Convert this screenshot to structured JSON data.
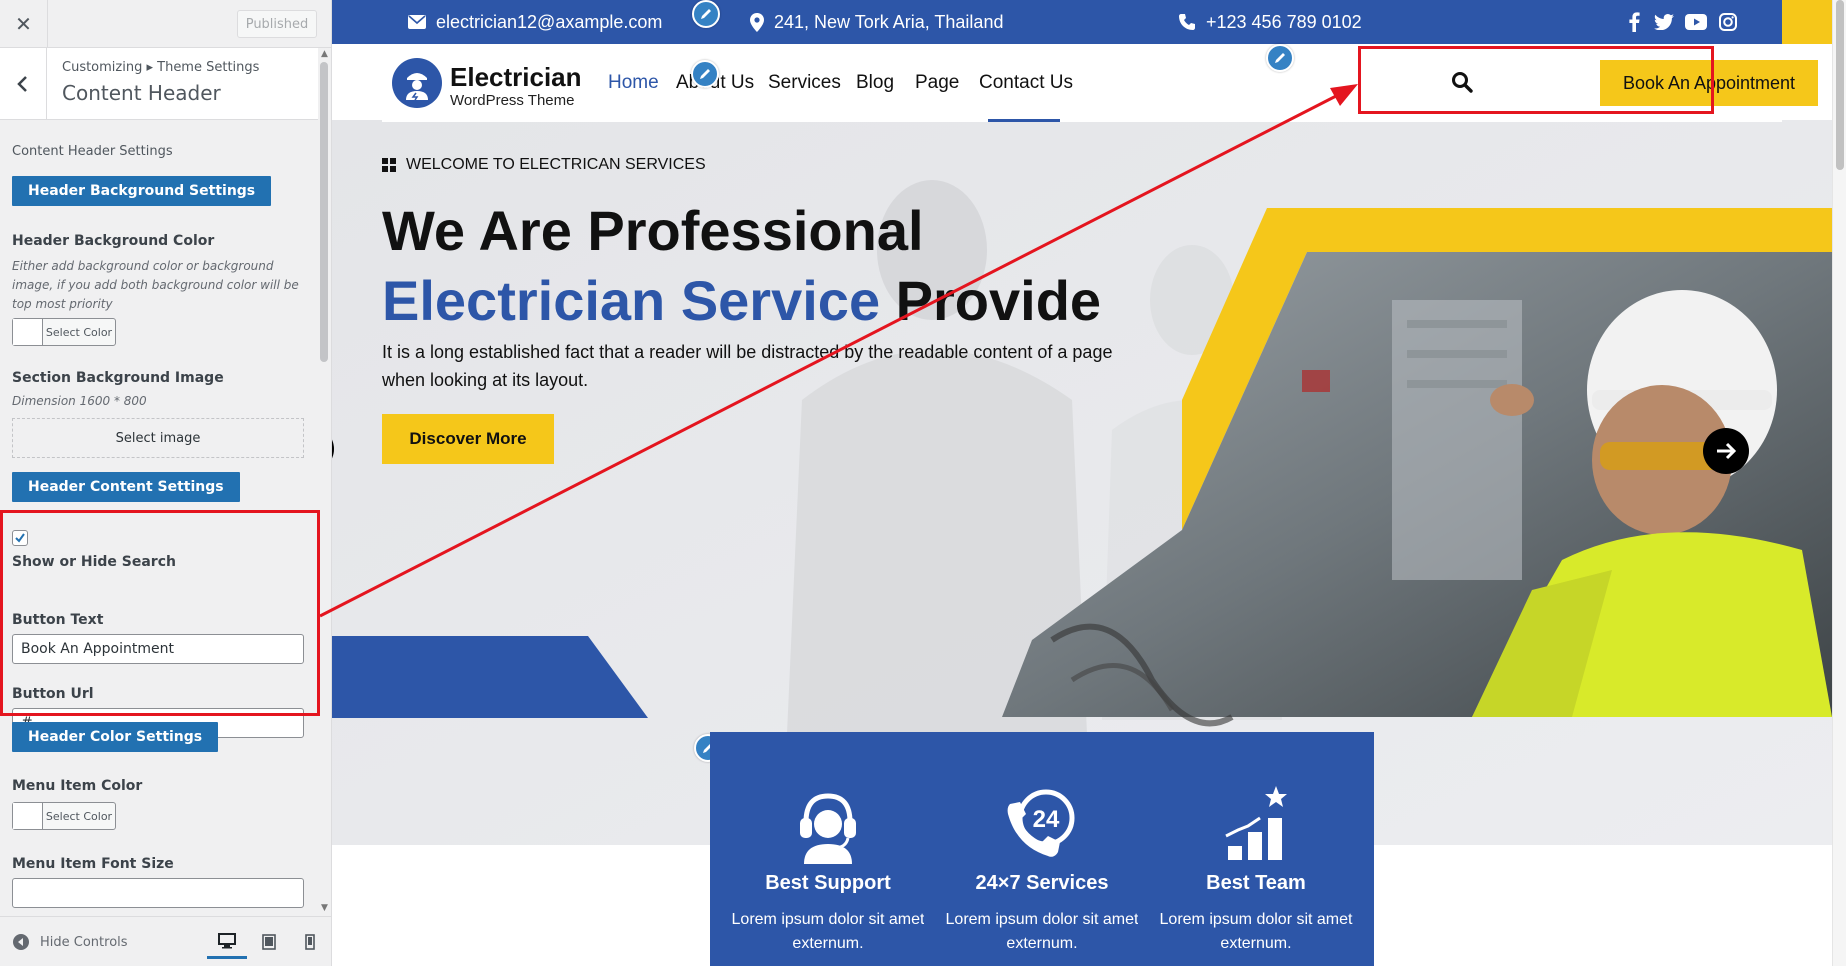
{
  "sidebar": {
    "close_icon": "close-icon",
    "published_label": "Published",
    "breadcrumb": "Customizing ▸ Theme Settings",
    "title": "Content Header",
    "section_label": "Content Header Settings",
    "bg_settings_button": "Header Background Settings",
    "bg_color_heading": "Header Background Color",
    "bg_color_desc": "Either add background color or background image, if you add both background color will be top most priority",
    "select_color_label": "Select Color",
    "bg_image_heading": "Section Background Image",
    "bg_image_desc": "Dimension 1600 * 800",
    "select_image_label": "Select image",
    "content_settings_button": "Header Content Settings",
    "show_search_checked": true,
    "show_search_label": "Show or Hide Search",
    "button_text_heading": "Button Text",
    "button_text_value": "Book An Appointment",
    "button_url_heading": "Button Url",
    "button_url_value": "#",
    "color_settings_button": "Header Color Settings",
    "menu_color_heading": "Menu Item Color",
    "menu_color_select_label": "Select Color",
    "menu_font_heading": "Menu Item Font Size",
    "menu_font_value": "",
    "hide_controls_label": "Hide Controls",
    "devices": [
      "desktop-icon",
      "tablet-icon",
      "mobile-icon"
    ]
  },
  "preview": {
    "topbar": {
      "email": "electrician12@axample.com",
      "address": "241, New Tork Aria, Thailand",
      "phone": "+123 456 789 0102",
      "social": [
        "facebook-icon",
        "twitter-icon",
        "youtube-icon",
        "instagram-icon"
      ]
    },
    "logo": {
      "name": "Electrician",
      "tagline": "WordPress Theme"
    },
    "nav": [
      "Home",
      "About Us",
      "Services",
      "Blog",
      "Page",
      "Contact Us"
    ],
    "active_nav": "Home",
    "header_button": "Book An Appointment",
    "hero": {
      "welcome": "WELCOME TO ELECTRICAN SERVICES",
      "line1": "We Are Professional",
      "line2_blue": "Electrician Service",
      "line2_black": "Provide",
      "description": "It is a long established fact that a reader will be distracted by the readable content of a page when looking at its layout.",
      "cta": "Discover More"
    },
    "features": [
      {
        "title": "Best Support",
        "text": "Lorem ipsum dolor sit amet externum.",
        "icon": "headset-icon"
      },
      {
        "title": "24×7 Services",
        "text": "Lorem ipsum dolor sit amet externum.",
        "icon": "phone-24-icon"
      },
      {
        "title": "Best Team",
        "text": "Lorem ipsum dolor sit amet externum.",
        "icon": "team-chart-icon"
      }
    ]
  },
  "colors": {
    "brand_blue": "#2d56a8",
    "brand_yellow": "#f5c71a",
    "wp_blue": "#2271b1",
    "annotation_red": "#e4151f"
  }
}
